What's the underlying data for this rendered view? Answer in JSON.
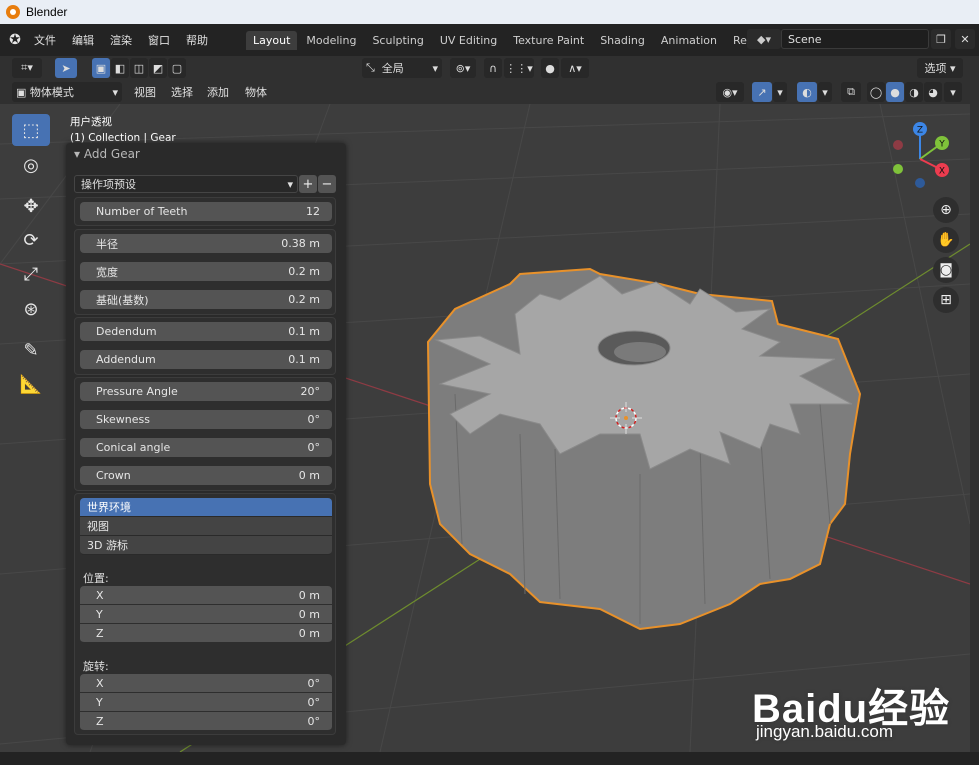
{
  "window": {
    "title": "Blender"
  },
  "menu": [
    "文件",
    "编辑",
    "渲染",
    "窗口",
    "帮助"
  ],
  "workspace_tabs": [
    {
      "label": "Layout",
      "active": true
    },
    {
      "label": "Modeling"
    },
    {
      "label": "Sculpting"
    },
    {
      "label": "UV Editing"
    },
    {
      "label": "Texture Paint"
    },
    {
      "label": "Shading"
    },
    {
      "label": "Animation"
    },
    {
      "label": "Rendering"
    }
  ],
  "scene": {
    "name": "Scene"
  },
  "tool_settings": {
    "transform_orientation": "全局",
    "options_label": "选项"
  },
  "header": {
    "mode": "物体模式",
    "menus": [
      "视图",
      "选择",
      "添加",
      "物体"
    ]
  },
  "viewport": {
    "view_name": "用户透视",
    "collection_info": "(1) Collection | Gear"
  },
  "operator_panel": {
    "title": "Add Gear",
    "preset_label": "操作项预设",
    "number_of_teeth": {
      "label": "Number of Teeth",
      "value": "12"
    },
    "radius": {
      "label": "半径",
      "value": "0.38 m"
    },
    "width": {
      "label": "宽度",
      "value": "0.2 m"
    },
    "base": {
      "label": "基础(基数)",
      "value": "0.2 m"
    },
    "dedendum": {
      "label": "Dedendum",
      "value": "0.1 m"
    },
    "addendum": {
      "label": "Addendum",
      "value": "0.1 m"
    },
    "pressure_angle": {
      "label": "Pressure Angle",
      "value": "20°"
    },
    "skewness": {
      "label": "Skewness",
      "value": "0°"
    },
    "conical_angle": {
      "label": "Conical angle",
      "value": "0°"
    },
    "crown": {
      "label": "Crown",
      "value": "0 m"
    },
    "align_options": [
      "世界环境",
      "视图",
      "3D 游标"
    ],
    "align_selected": "世界环境",
    "location_label": "位置:",
    "location": [
      {
        "axis": "X",
        "value": "0 m"
      },
      {
        "axis": "Y",
        "value": "0 m"
      },
      {
        "axis": "Z",
        "value": "0 m"
      }
    ],
    "rotation_label": "旋转:",
    "rotation": [
      {
        "axis": "X",
        "value": "0°"
      },
      {
        "axis": "Y",
        "value": "0°"
      },
      {
        "axis": "Z",
        "value": "0°"
      }
    ]
  },
  "gizmo": {
    "axes": [
      "X",
      "Y",
      "Z"
    ]
  },
  "watermark": {
    "brand": "Baidu经验",
    "url": "jingyan.baidu.com"
  },
  "colors": {
    "accent": "#4772b3",
    "selection_outline": "#e8912a",
    "x_axis": "#ed3c4f",
    "y_axis": "#7fc23a",
    "z_axis": "#3c86e6",
    "annotation": "#c0121c"
  }
}
